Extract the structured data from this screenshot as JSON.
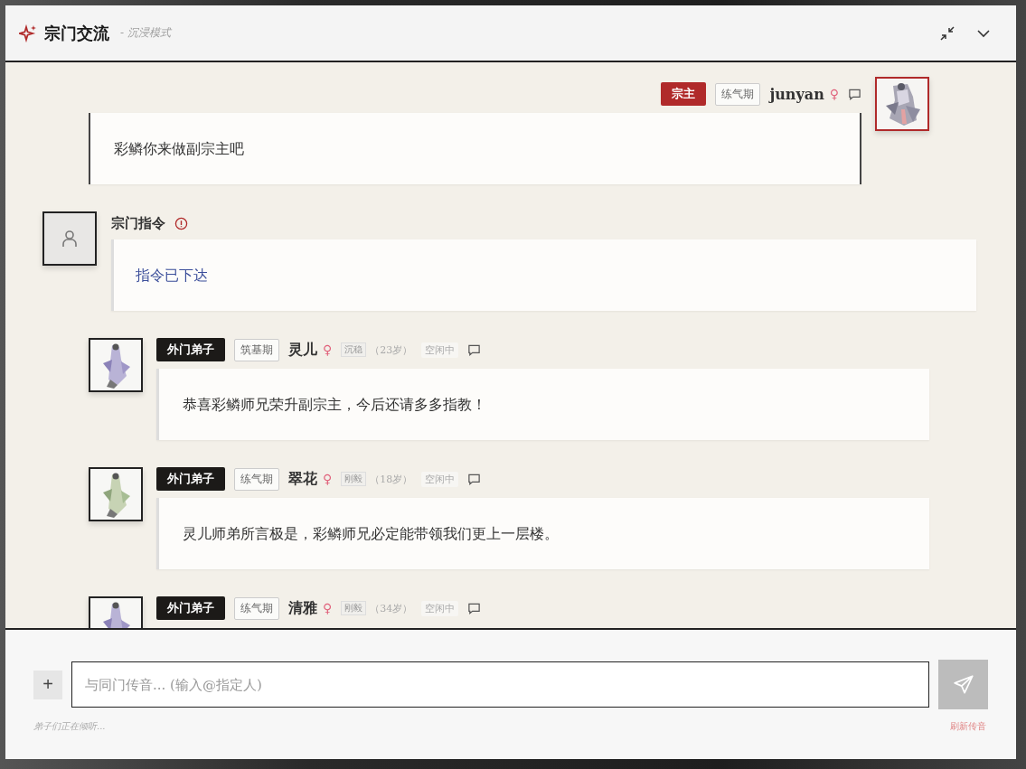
{
  "header": {
    "title": "宗门交流",
    "subtitle": "- 沉浸模式"
  },
  "messages": [
    {
      "kind": "self",
      "role": {
        "text": "宗主",
        "color": "#b02a2a"
      },
      "realm": "练气期",
      "name": "junyan",
      "gender": "♀",
      "text": "彩鳞你来做副宗主吧"
    },
    {
      "kind": "system",
      "name": "宗门指令",
      "text": "指令已下达"
    },
    {
      "kind": "member",
      "role": {
        "text": "外门弟子",
        "color": "#1c1a18"
      },
      "realm": "筑基期",
      "name": "灵儿",
      "gender": "♀",
      "trait": "沉稳",
      "age": "（23岁）",
      "status": "空闲中",
      "text": "恭喜彩鳞师兄荣升副宗主，今后还请多多指教！"
    },
    {
      "kind": "member",
      "role": {
        "text": "外门弟子",
        "color": "#1c1a18"
      },
      "realm": "练气期",
      "name": "翠花",
      "gender": "♀",
      "trait": "刚毅",
      "age": "（18岁）",
      "status": "空闲中",
      "text": "灵儿师弟所言极是，彩鳞师兄必定能带领我们更上一层楼。"
    },
    {
      "kind": "member",
      "role": {
        "text": "外门弟子",
        "color": "#1c1a18"
      },
      "realm": "练气期",
      "name": "清雅",
      "gender": "♀",
      "trait": "刚毅",
      "age": "（34岁）",
      "status": "空闲中"
    }
  ],
  "composer": {
    "add": "+",
    "placeholder": "与同门传音... (输入@指定人)",
    "hint": "弟子们正在倾听...",
    "refresh": "刷新传音"
  }
}
